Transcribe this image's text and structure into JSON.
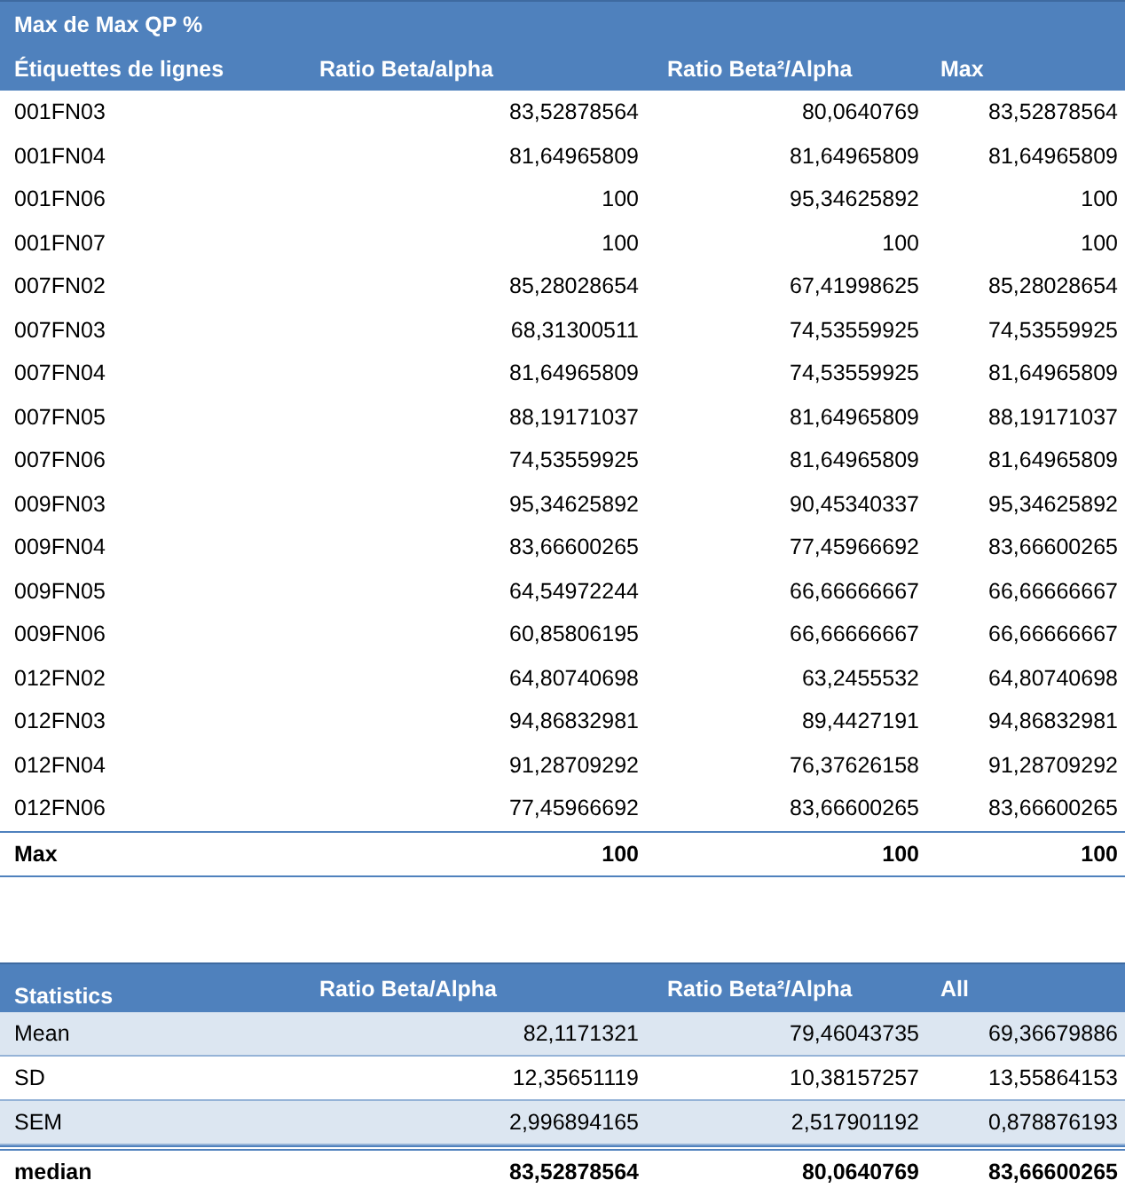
{
  "pivot": {
    "title": "Max de Max QP %",
    "columns": [
      "Étiquettes de lignes",
      "Ratio Beta/alpha",
      "Ratio Beta²/Alpha",
      "Max"
    ],
    "rows": [
      {
        "label": "001FN03",
        "values": [
          "83,52878564",
          "80,0640769",
          "83,52878564"
        ]
      },
      {
        "label": "001FN04",
        "values": [
          "81,64965809",
          "81,64965809",
          "81,64965809"
        ]
      },
      {
        "label": "001FN06",
        "values": [
          "100",
          "95,34625892",
          "100"
        ]
      },
      {
        "label": "001FN07",
        "values": [
          "100",
          "100",
          "100"
        ]
      },
      {
        "label": "007FN02",
        "values": [
          "85,28028654",
          "67,41998625",
          "85,28028654"
        ]
      },
      {
        "label": "007FN03",
        "values": [
          "68,31300511",
          "74,53559925",
          "74,53559925"
        ]
      },
      {
        "label": "007FN04",
        "values": [
          "81,64965809",
          "74,53559925",
          "81,64965809"
        ]
      },
      {
        "label": "007FN05",
        "values": [
          "88,19171037",
          "81,64965809",
          "88,19171037"
        ]
      },
      {
        "label": "007FN06",
        "values": [
          "74,53559925",
          "81,64965809",
          "81,64965809"
        ]
      },
      {
        "label": "009FN03",
        "values": [
          "95,34625892",
          "90,45340337",
          "95,34625892"
        ]
      },
      {
        "label": "009FN04",
        "values": [
          "83,66600265",
          "77,45966692",
          "83,66600265"
        ]
      },
      {
        "label": "009FN05",
        "values": [
          "64,54972244",
          "66,66666667",
          "66,66666667"
        ]
      },
      {
        "label": "009FN06",
        "values": [
          "60,85806195",
          "66,66666667",
          "66,66666667"
        ]
      },
      {
        "label": "012FN02",
        "values": [
          "64,80740698",
          "63,2455532",
          "64,80740698"
        ]
      },
      {
        "label": "012FN03",
        "values": [
          "94,86832981",
          "89,4427191",
          "94,86832981"
        ]
      },
      {
        "label": "012FN04",
        "values": [
          "91,28709292",
          "76,37626158",
          "91,28709292"
        ]
      },
      {
        "label": "012FN06",
        "values": [
          "77,45966692",
          "83,66600265",
          "83,66600265"
        ]
      }
    ],
    "total": {
      "label": "Max",
      "values": [
        "100",
        "100",
        "100"
      ]
    }
  },
  "statistics": {
    "columns": [
      "Statistics",
      "Ratio Beta/Alpha",
      "Ratio Beta²/Alpha",
      "All"
    ],
    "rows": [
      {
        "label": "Mean",
        "values": [
          "82,1171321",
          "79,46043735",
          "69,36679886"
        ]
      },
      {
        "label": "SD",
        "values": [
          "12,35651119",
          "10,38157257",
          "13,55864153"
        ]
      },
      {
        "label": "SEM",
        "values": [
          "2,996894165",
          "2,517901192",
          "0,878876193"
        ]
      }
    ],
    "total": {
      "label": "median",
      "values": [
        "83,52878564",
        "80,0640769",
        "83,66600265"
      ]
    }
  }
}
